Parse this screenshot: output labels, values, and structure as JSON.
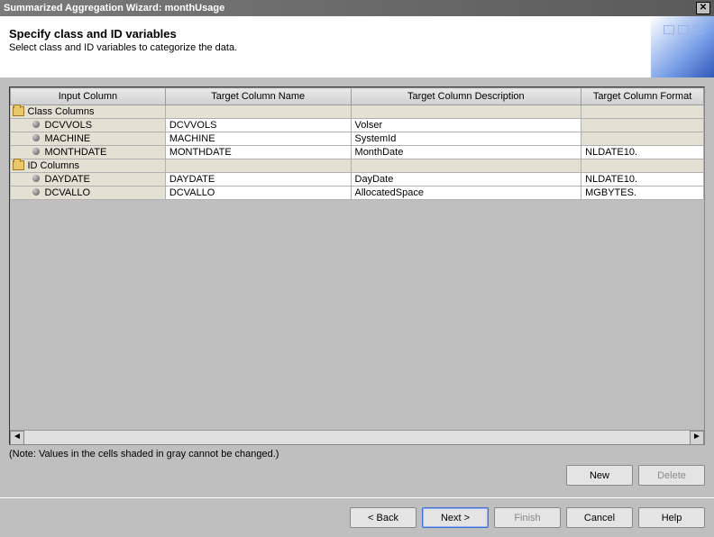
{
  "window": {
    "title": "Summarized Aggregation Wizard: monthUsage"
  },
  "header": {
    "heading": "Specify class and ID variables",
    "subtext": "Select class and ID variables to categorize the data."
  },
  "table": {
    "headers": {
      "input": "Input Column",
      "name": "Target Column Name",
      "desc": "Target Column Description",
      "fmt": "Target Column Format"
    },
    "groups": [
      {
        "label": "Class Columns",
        "rows": [
          {
            "input": "DCVVOLS",
            "name": "DCVVOLS",
            "desc": "Volser",
            "fmt": ""
          },
          {
            "input": "MACHINE",
            "name": "MACHINE",
            "desc": "SystemId",
            "fmt": ""
          },
          {
            "input": "MONTHDATE",
            "name": "MONTHDATE",
            "desc": "MonthDate",
            "fmt": "NLDATE10."
          }
        ]
      },
      {
        "label": "ID Columns",
        "rows": [
          {
            "input": "DAYDATE",
            "name": "DAYDATE",
            "desc": "DayDate",
            "fmt": "NLDATE10."
          },
          {
            "input": "DCVALLO",
            "name": "DCVALLO",
            "desc": "AllocatedSpace",
            "fmt": "MGBYTES."
          }
        ]
      }
    ]
  },
  "note": "(Note: Values in the cells shaded in gray cannot be changed.)",
  "buttons": {
    "new": "New",
    "delete": "Delete",
    "back": "< Back",
    "next": "Next >",
    "finish": "Finish",
    "cancel": "Cancel",
    "help": "Help"
  }
}
